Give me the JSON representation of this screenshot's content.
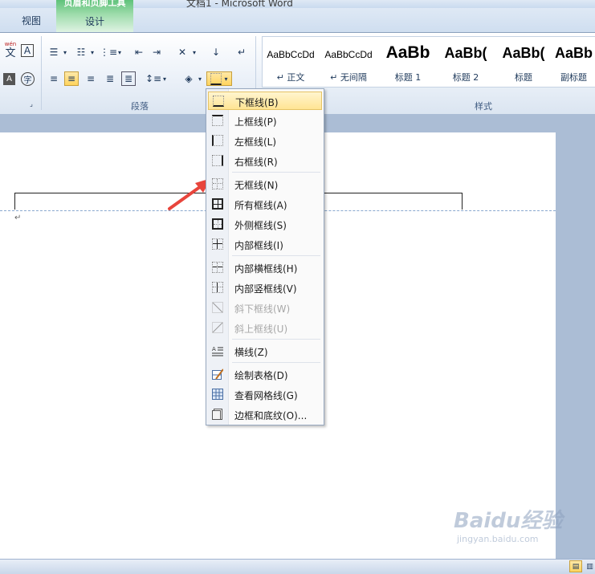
{
  "window": {
    "title": "文档1 - Microsoft Word"
  },
  "tabs": {
    "view": "视图",
    "context_group": "页眉和页脚工具",
    "design": "设计"
  },
  "ribbon": {
    "paragraph_group_label": "段落",
    "styles_group_label": "样式",
    "styles": [
      {
        "sample": "AaBbCcDd",
        "name": "↵ 正文"
      },
      {
        "sample": "AaBbCcDd",
        "name": "↵ 无间隔"
      },
      {
        "sample": "AaBb",
        "name": "标题 1"
      },
      {
        "sample": "AaBb(",
        "name": "标题 2"
      },
      {
        "sample": "AaBb(",
        "name": "标题"
      },
      {
        "sample": "AaBb",
        "name": "副标题"
      }
    ],
    "font_glyphs": {
      "phonetic": "文",
      "phonetic_top": "wén",
      "char_border": "A",
      "highlight": "A",
      "enclose": "字"
    }
  },
  "document": {
    "paragraph_mark": "↵"
  },
  "border_menu": {
    "items": [
      {
        "label": "下框线(B)",
        "icon": "bottom-border-icon"
      },
      {
        "label": "上框线(P)",
        "icon": "top-border-icon"
      },
      {
        "label": "左框线(L)",
        "icon": "left-border-icon"
      },
      {
        "label": "右框线(R)",
        "icon": "right-border-icon"
      },
      {
        "label": "无框线(N)",
        "icon": "no-border-icon"
      },
      {
        "label": "所有框线(A)",
        "icon": "all-borders-icon"
      },
      {
        "label": "外侧框线(S)",
        "icon": "outside-borders-icon"
      },
      {
        "label": "内部框线(I)",
        "icon": "inside-borders-icon"
      },
      {
        "label": "内部横框线(H)",
        "icon": "inside-horizontal-border-icon"
      },
      {
        "label": "内部竖框线(V)",
        "icon": "inside-vertical-border-icon"
      },
      {
        "label": "斜下框线(W)",
        "icon": "diagonal-down-border-icon"
      },
      {
        "label": "斜上框线(U)",
        "icon": "diagonal-up-border-icon"
      },
      {
        "label": "横线(Z)",
        "icon": "horizontal-line-icon"
      },
      {
        "label": "绘制表格(D)",
        "icon": "draw-table-icon"
      },
      {
        "label": "查看网格线(G)",
        "icon": "view-gridlines-icon"
      },
      {
        "label": "边框和底纹(O)...",
        "icon": "borders-shading-icon"
      }
    ]
  },
  "watermark": {
    "brand": "Baidu经验",
    "url": "jingyan.baidu.com"
  },
  "colors": {
    "annotation_arrow": "#e8453c",
    "highlight": "#ffd45e"
  }
}
